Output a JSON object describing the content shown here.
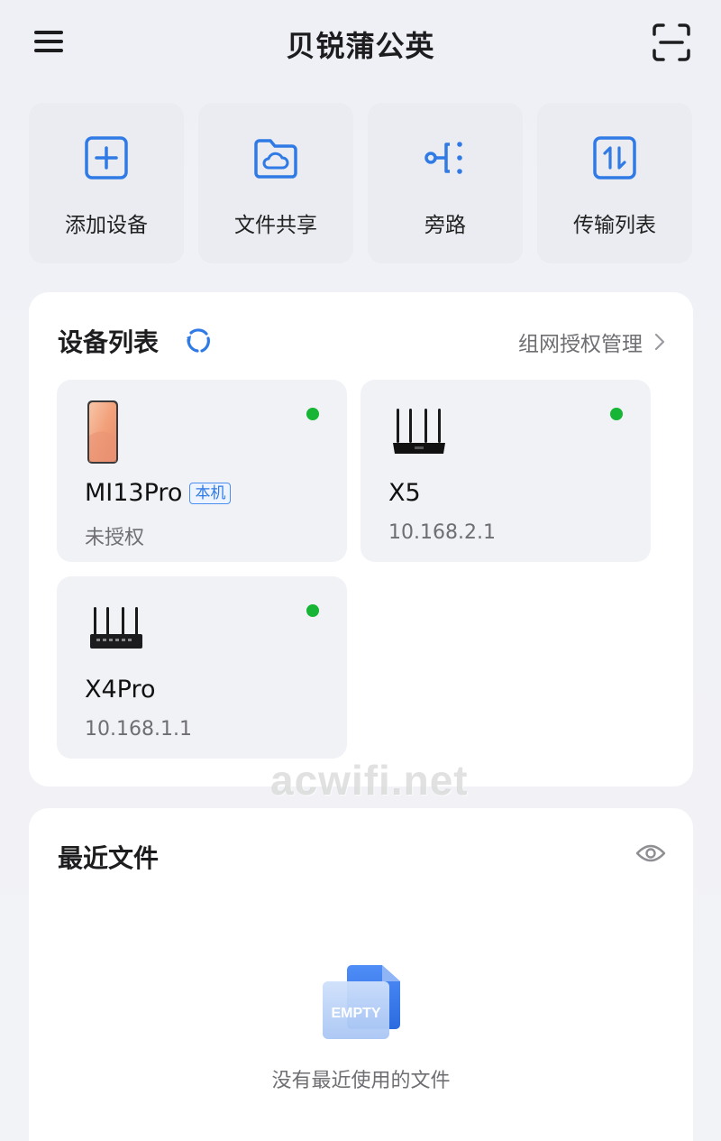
{
  "header": {
    "title": "贝锐蒲公英",
    "menu_icon": "menu-icon",
    "scan_icon": "scan-icon"
  },
  "quick_actions": [
    {
      "label": "添加设备",
      "icon": "add-icon"
    },
    {
      "label": "文件共享",
      "icon": "cloud-folder-icon"
    },
    {
      "label": "旁路",
      "icon": "bypass-icon"
    },
    {
      "label": "传输列表",
      "icon": "transfer-icon"
    }
  ],
  "device_list": {
    "title": "设备列表",
    "manage_label": "组网授权管理",
    "devices": [
      {
        "name": "MI13Pro",
        "badge": "本机",
        "sub": "未授权",
        "online": true,
        "type": "phone"
      },
      {
        "name": "X5",
        "sub": "10.168.2.1",
        "online": true,
        "type": "router"
      },
      {
        "name": "X4Pro",
        "sub": "10.168.1.1",
        "online": true,
        "type": "router"
      }
    ]
  },
  "recent_files": {
    "title": "最近文件",
    "empty_badge": "EMPTY",
    "empty_text": "没有最近使用的文件"
  },
  "watermark": "acwifi.net",
  "colors": {
    "accent": "#2f7ae5",
    "online": "#17b535",
    "background": "#f1f2f6",
    "card": "#ffffff"
  }
}
